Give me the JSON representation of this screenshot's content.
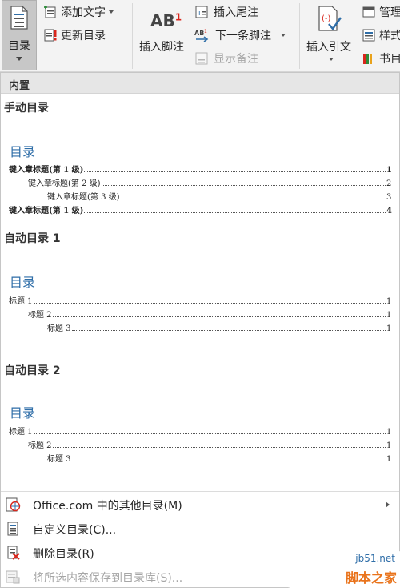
{
  "ribbon": {
    "toc_button": {
      "label": "目录",
      "icon": "toc-document-icon"
    },
    "add_text": {
      "label": "添加文字",
      "icon": "add-text-icon"
    },
    "update_toc": {
      "label": "更新目录",
      "icon": "update-toc-icon"
    },
    "insert_footnote": {
      "label": "插入脚注",
      "icon_text": "AB",
      "icon_sup": "1"
    },
    "insert_endnote": {
      "label": "插入尾注",
      "icon": "endnote-icon"
    },
    "next_footnote": {
      "label": "下一条脚注",
      "icon": "next-footnote-icon"
    },
    "show_notes": {
      "label": "显示备注",
      "icon": "show-notes-icon"
    },
    "insert_citation": {
      "label": "插入引文",
      "icon": "citation-icon"
    },
    "manage": {
      "label": "管理",
      "icon": "manage-sources-icon"
    },
    "style": {
      "label": "样式",
      "icon": "style-icon"
    },
    "bibliography": {
      "label": "书目",
      "icon": "bibliography-icon"
    }
  },
  "panel": {
    "section_header": "内置",
    "galleries": [
      {
        "title": "手动目录",
        "heading": "目录",
        "entries": [
          {
            "text": "键入章标题(第 1 级)",
            "page": "1",
            "level": 1,
            "bold": true
          },
          {
            "text": "键入章标题(第 2 级)",
            "page": "2",
            "level": 2,
            "bold": false
          },
          {
            "text": "键入章标题(第 3 级)",
            "page": "3",
            "level": 3,
            "bold": false
          },
          {
            "text": "键入章标题(第 1 级)",
            "page": "4",
            "level": 1,
            "bold": true
          }
        ]
      },
      {
        "title": "自动目录 1",
        "heading": "目录",
        "entries": [
          {
            "text": "标题 1",
            "page": "1",
            "level": 1,
            "bold": false
          },
          {
            "text": "标题 2",
            "page": "1",
            "level": 2,
            "bold": false
          },
          {
            "text": "标题 3",
            "page": "1",
            "level": 3,
            "bold": false
          }
        ]
      },
      {
        "title": "自动目录 2",
        "heading": "目录",
        "entries": [
          {
            "text": "标题 1",
            "page": "1",
            "level": 1,
            "bold": false
          },
          {
            "text": "标题 2",
            "page": "1",
            "level": 2,
            "bold": false
          },
          {
            "text": "标题 3",
            "page": "1",
            "level": 3,
            "bold": false
          }
        ]
      }
    ],
    "menu": [
      {
        "label": "Office.com 中的其他目录(M)",
        "icon": "office-globe-icon",
        "submenu": true,
        "disabled": false
      },
      {
        "label": "自定义目录(C)...",
        "icon": "custom-toc-icon",
        "submenu": false,
        "disabled": false
      },
      {
        "label": "删除目录(R)",
        "icon": "remove-toc-icon",
        "submenu": false,
        "disabled": false
      },
      {
        "label": "将所选内容保存到目录库(S)...",
        "icon": "save-to-gallery-icon",
        "submenu": false,
        "disabled": true
      }
    ]
  },
  "watermark": {
    "site": "jb51.net",
    "brand": "脚本之家"
  },
  "colors": {
    "accent_blue": "#2f6ea8",
    "ribbon_bg": "#f3f3f3",
    "section_bg": "#e6e6e6"
  }
}
